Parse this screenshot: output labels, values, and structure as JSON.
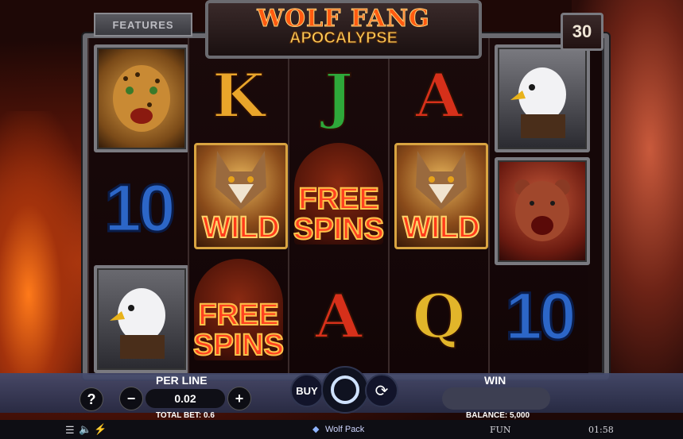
{
  "game": {
    "title_main": "WOLF FANG",
    "title_sub": "APOCALYPSE",
    "features_label": "FEATURES",
    "lines_count": "30"
  },
  "reels": [
    [
      "leopard",
      "10",
      "eagle"
    ],
    [
      "K",
      "WILD",
      "FREE SPINS"
    ],
    [
      "J",
      "FREE SPINS",
      "A"
    ],
    [
      "A",
      "WILD",
      "Q"
    ],
    [
      "eagle",
      "bear",
      "10"
    ]
  ],
  "symbols": {
    "wild_label": "WILD",
    "free_line1": "FREE",
    "free_line2": "SPINS",
    "ten": "10",
    "k": "K",
    "j": "J",
    "a": "A",
    "q": "Q"
  },
  "controls": {
    "help_label": "?",
    "per_line_label": "PER LINE",
    "per_line_value": "0.02",
    "minus_label": "−",
    "plus_label": "+",
    "total_bet_label": "TOTAL BET: 0.6",
    "buy_label": "BUY",
    "win_label": "WIN",
    "balance_label": "BALANCE: 5,000"
  },
  "status": {
    "brand": "Wolf Pack",
    "mode": "FUN",
    "time": "01:58"
  },
  "colors": {
    "panel": "#464c6e",
    "accent_blue": "#cfe2ff",
    "title_orange": "#ff5a10"
  }
}
